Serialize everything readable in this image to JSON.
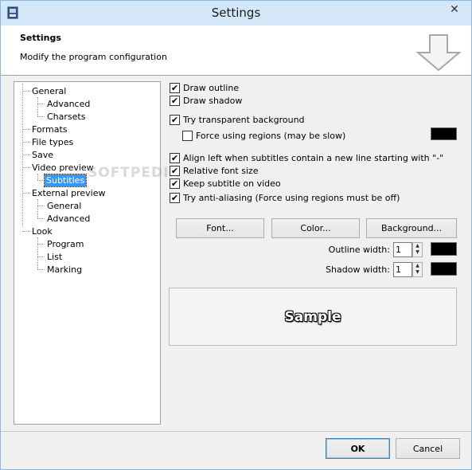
{
  "window": {
    "title": "Settings",
    "close_glyph": "✕"
  },
  "header": {
    "title": "Settings",
    "subtitle": "Modify the program configuration"
  },
  "tree": {
    "watermark": "SOFTPEDIA",
    "items": [
      {
        "label": "General"
      },
      {
        "label": "Advanced"
      },
      {
        "label": "Charsets"
      },
      {
        "label": "Formats"
      },
      {
        "label": "File types"
      },
      {
        "label": "Save"
      },
      {
        "label": "Video preview"
      },
      {
        "label": "Subtitles"
      },
      {
        "label": "External preview"
      },
      {
        "label": "General"
      },
      {
        "label": "Advanced"
      },
      {
        "label": "Look"
      },
      {
        "label": "Program"
      },
      {
        "label": "List"
      },
      {
        "label": "Marking"
      }
    ],
    "selected": "Subtitles"
  },
  "options": {
    "draw_outline": {
      "label": "Draw outline",
      "checked": true
    },
    "draw_shadow": {
      "label": "Draw shadow",
      "checked": true
    },
    "transparent_bg": {
      "label": "Try transparent background",
      "checked": true
    },
    "force_regions": {
      "label": "Force using regions (may be slow)",
      "checked": false
    },
    "align_left": {
      "label": "Align left when subtitles contain a new line starting with \"-\"",
      "checked": true
    },
    "relative_font": {
      "label": "Relative font size",
      "checked": true
    },
    "keep_on_video": {
      "label": "Keep subtitle on video",
      "checked": true
    },
    "anti_aliasing": {
      "label": "Try anti-aliasing (Force using regions must be off)",
      "checked": true
    },
    "check_glyph": "✔"
  },
  "buttons": {
    "font": "Font...",
    "color": "Color...",
    "background": "Background...",
    "ok": "OK",
    "cancel": "Cancel"
  },
  "spinners": {
    "outline_label": "Outline width:",
    "outline_value": "1",
    "shadow_label": "Shadow width:",
    "shadow_value": "1",
    "up_glyph": "▲",
    "down_glyph": "▼"
  },
  "sample": {
    "text": "Sample"
  },
  "colors": {
    "swatch": "#000000",
    "selection": "#3399ff",
    "titlebar": "#d4e7f8"
  },
  "icons": {
    "app": "app-icon",
    "arrow": "down-arrow-icon",
    "close": "close-icon"
  }
}
